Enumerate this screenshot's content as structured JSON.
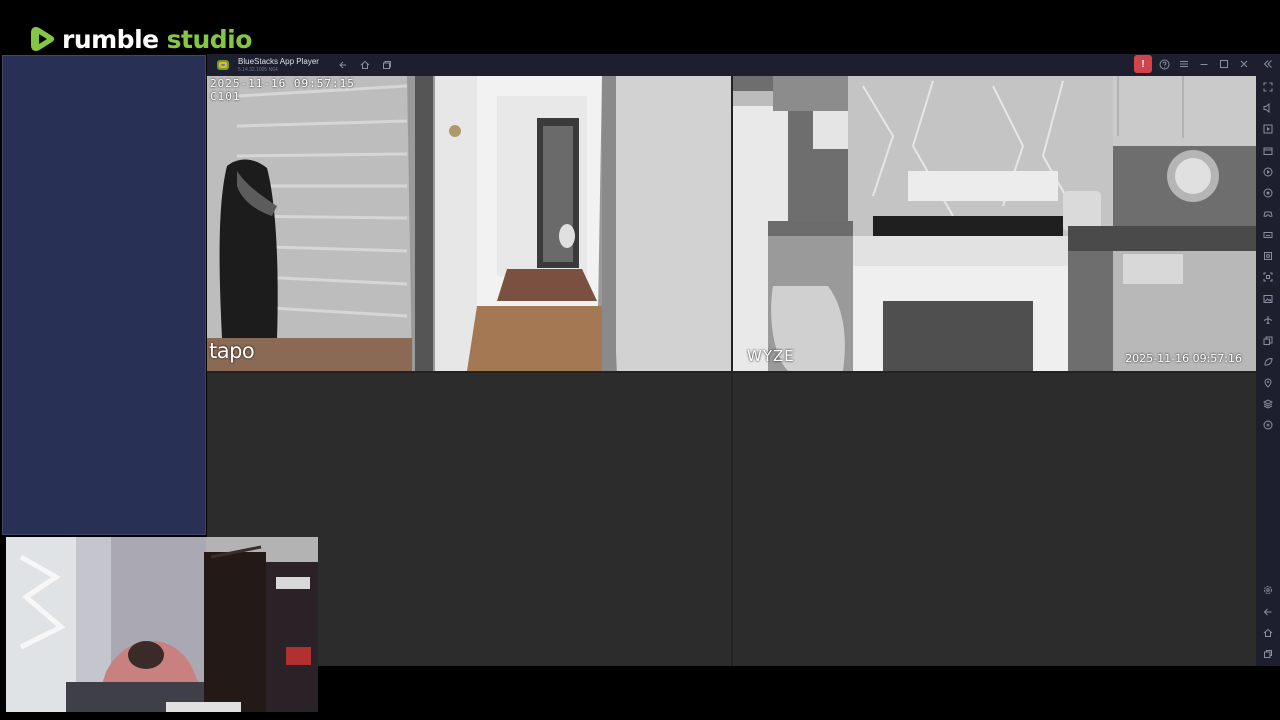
{
  "brand": {
    "word1": "rumble",
    "word2": "studio",
    "accent": "#85c742"
  },
  "window": {
    "title": "BlueStacks App Player",
    "version": "5.14.32.1005 N64",
    "titlebar_icons": [
      "back-icon",
      "home-icon",
      "multi-instance-icon"
    ],
    "right_icons": [
      "alert-icon",
      "help-icon",
      "menu-icon",
      "minimize-icon",
      "maximize-icon",
      "close-icon",
      "collapse-sidebar-icon"
    ],
    "alert_glyph": "!"
  },
  "sidebar_icons": [
    "fullscreen-icon",
    "volume-icon",
    "media-icon",
    "screenshot-icon",
    "record-icon",
    "rotate-icon",
    "gamepad-icon",
    "keyboard-icon",
    "capture-icon",
    "resize-icon",
    "gallery-icon",
    "airplane-icon",
    "multi-instance-icon",
    "eco-icon",
    "location-icon",
    "layers-icon",
    "sync-icon",
    "settings-icon",
    "back-icon",
    "home-icon",
    "recent-apps-icon"
  ],
  "cameras": {
    "left": {
      "timestamp": "2025-11-16 09:57:15",
      "camera_id": "C101",
      "brand": "tapo"
    },
    "right": {
      "timestamp": "2025-11-16 09:57:16",
      "brand": "WYZE"
    }
  }
}
